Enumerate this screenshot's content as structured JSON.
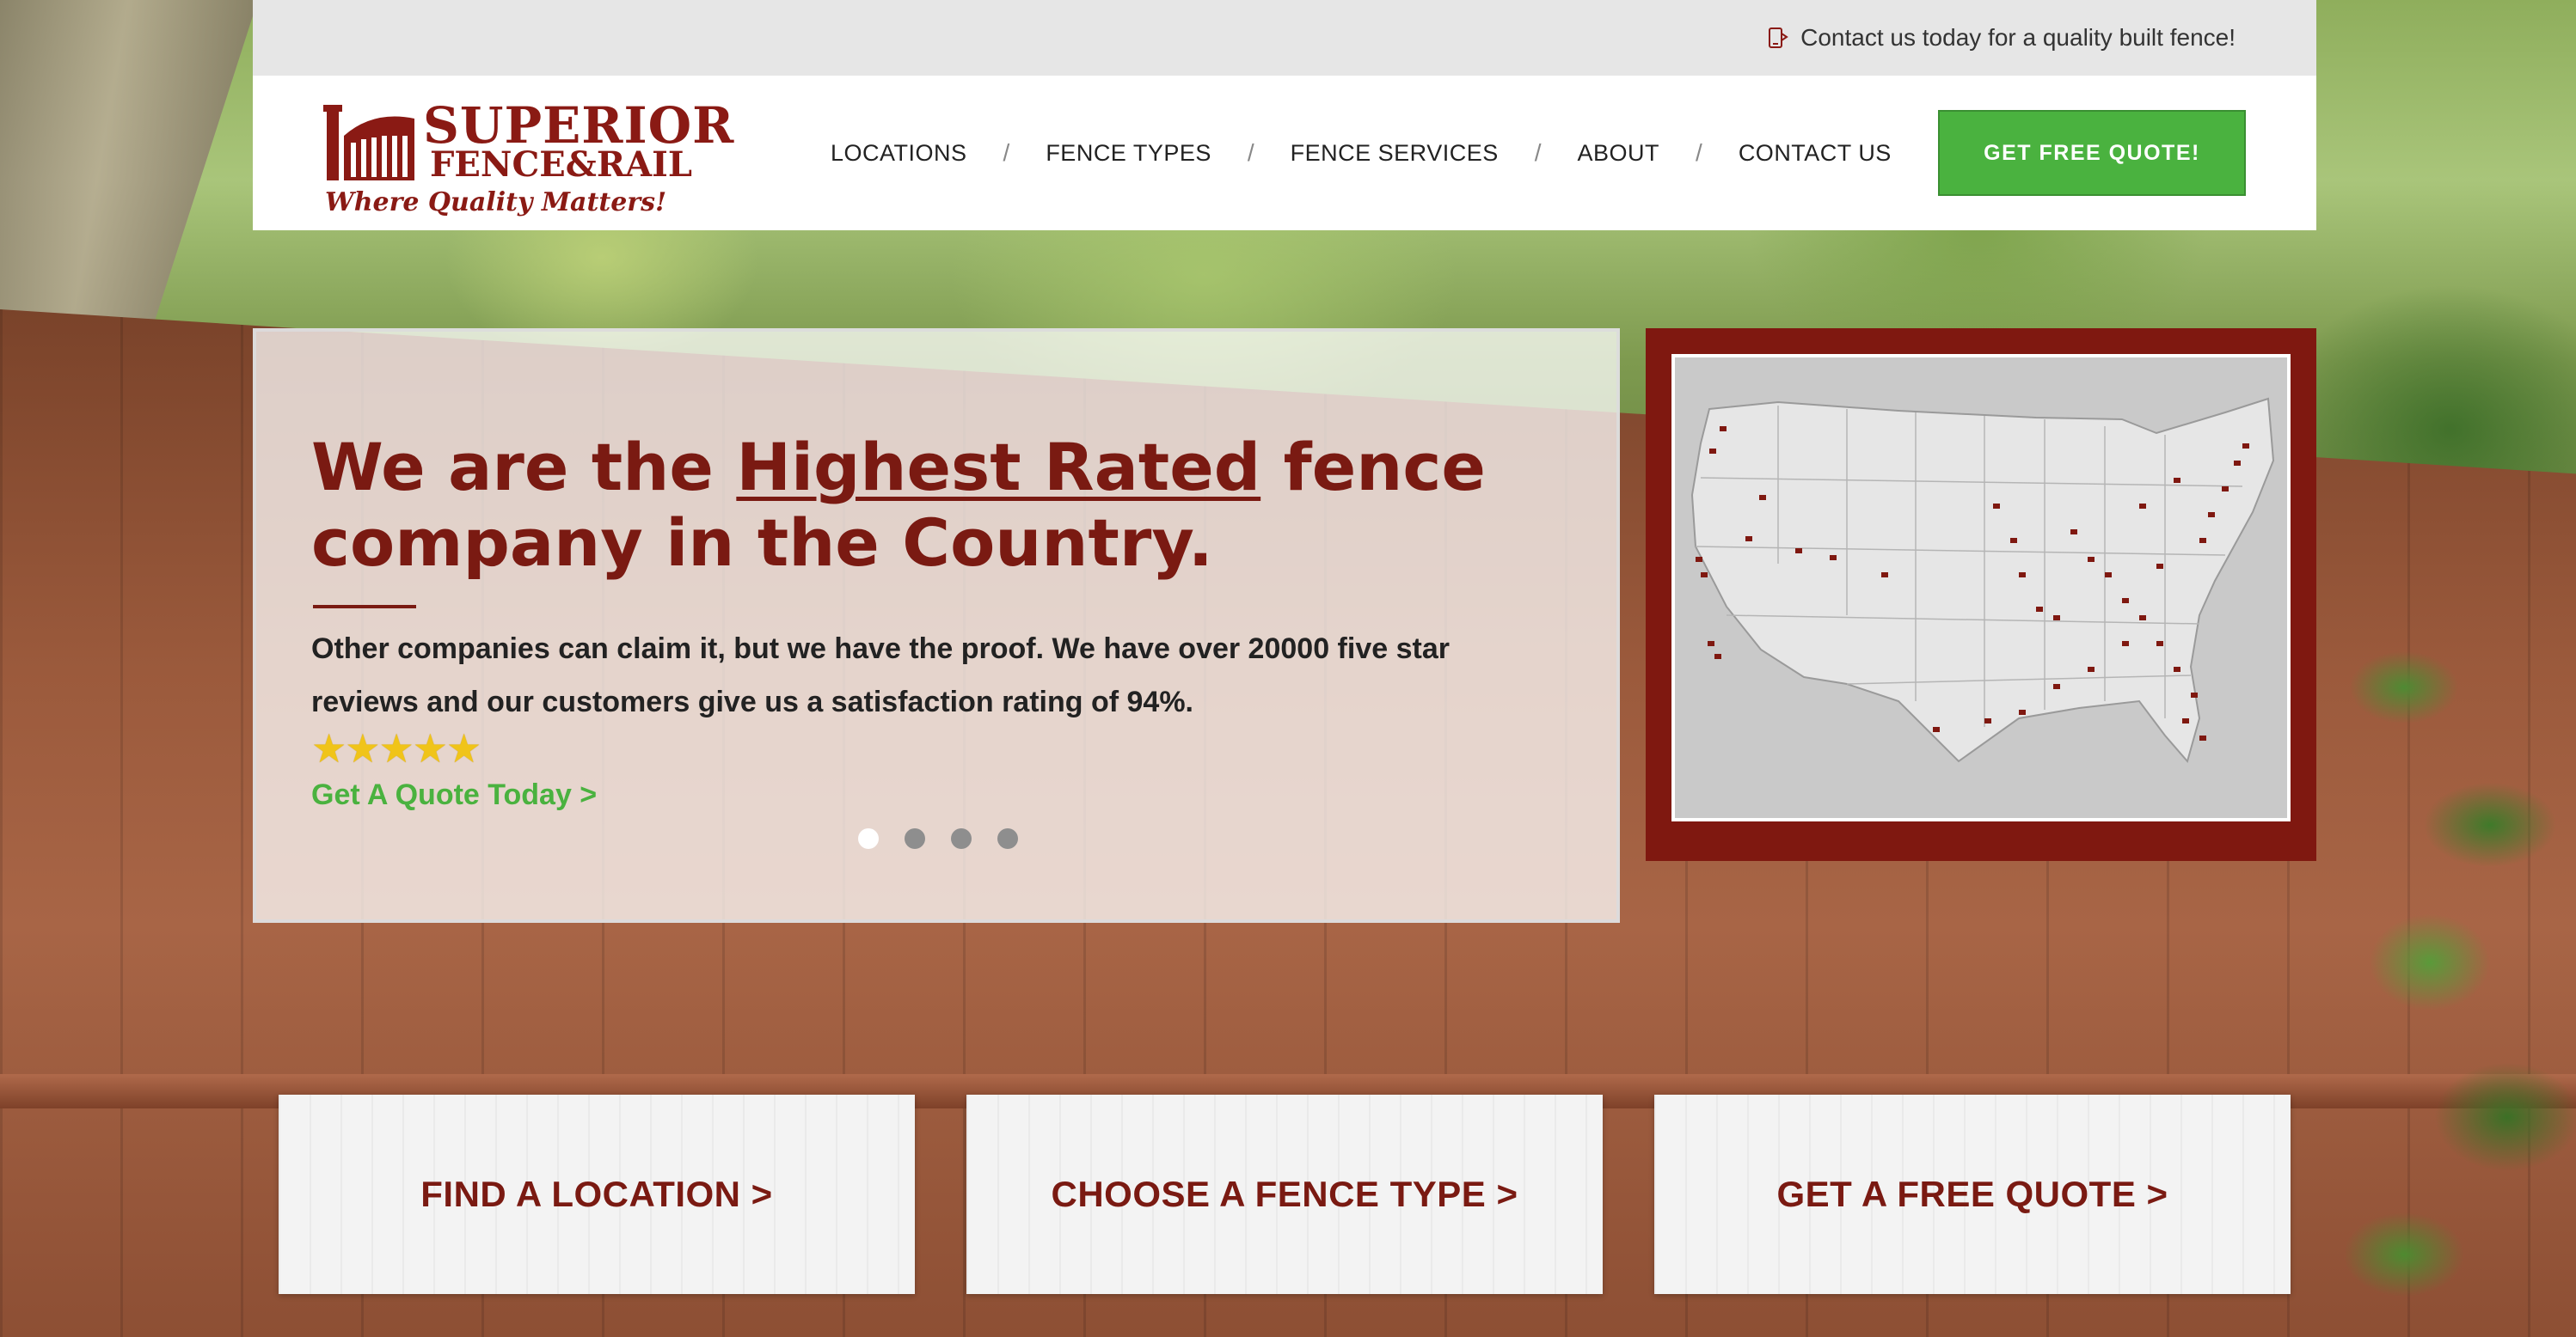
{
  "topbar": {
    "contact_text": "Contact us today for a quality built fence!",
    "icon": "phone-icon"
  },
  "logo": {
    "name_line1": "SUPERIOR",
    "name_line2": "FENCE&RAIL",
    "tagline": "Where Quality Matters!"
  },
  "nav": {
    "items": [
      {
        "label": "LOCATIONS"
      },
      {
        "label": "FENCE TYPES"
      },
      {
        "label": "FENCE SERVICES"
      },
      {
        "label": "ABOUT"
      },
      {
        "label": "CONTACT US"
      }
    ],
    "separator": "/",
    "cta_label": "GET FREE QUOTE!"
  },
  "hero": {
    "title_pre": "We are the ",
    "title_highlight": "Highest Rated",
    "title_post": " fence company in the Country.",
    "body": "Other companies can claim it, but we have the proof. We have over 20000 five star reviews and our customers give us a satisfaction rating of 94%.",
    "rating_stars": 5,
    "link_label": "Get A Quote Today >",
    "slides_total": 4,
    "active_slide": 1
  },
  "cards": {
    "find_location": "FIND A LOCATION >",
    "choose_fence": "CHOOSE A FENCE TYPE >",
    "free_quote": "GET A FREE QUOTE >"
  },
  "colors": {
    "brand_red": "#7a1a12",
    "cta_green": "#4ab23f",
    "topbar_gray": "#e6e6e6"
  }
}
